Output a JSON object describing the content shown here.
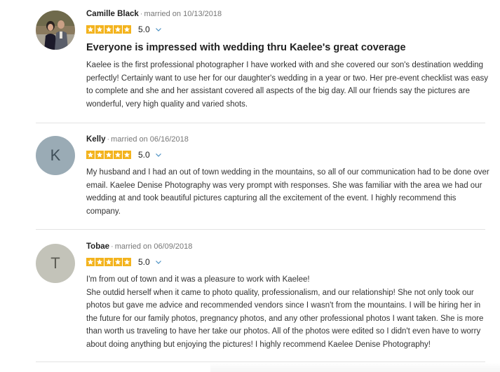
{
  "reviews": [
    {
      "name": "Camille Black",
      "married_text": "married on 10/13/2018",
      "rating": 5,
      "rating_text": "5.0",
      "avatar": "photo",
      "title": "Everyone is impressed with wedding thru Kaelee's great coverage",
      "body_lines": [
        "Kaelee is the first professional photographer I have worked with and she covered our son's destination wedding perfectly! Certainly want to use her for our daughter's wedding in a year or two. Her pre-event checklist was easy to complete and she and her assistant covered all aspects of the big day. All our friends say the pictures are wonderful, very high quality and varied shots."
      ]
    },
    {
      "name": "Kelly",
      "married_text": "married on 06/16/2018",
      "rating": 5,
      "rating_text": "5.0",
      "avatar_letter": "K",
      "body_lines": [
        "My husband and I had an out of town wedding in the mountains, so all of our communication had to be done over email. Kaelee Denise Photography was very prompt with responses. She was familiar with the area we had our wedding at and took beautiful pictures capturing all the excitement of the event. I highly recommend this company."
      ]
    },
    {
      "name": "Tobae",
      "married_text": "married on 06/09/2018",
      "rating": 5,
      "rating_text": "5.0",
      "avatar_letter": "T",
      "body_lines": [
        "I'm from out of town and it was a pleasure to work with Kaelee!",
        "She outdid herself when it came to photo quality, professionalism, and our relationship! She not only took our photos but gave me advice and recommended vendors since I wasn't from the mountains. I will be hiring her in the future for our family photos, pregnancy photos, and any other professional photos I want taken. She is more than worth us traveling to have her take our photos. All of the photos were edited so I didn't even have to worry about doing anything but enjoying the pictures! I highly recommend Kaelee Denise Photography!"
      ]
    }
  ],
  "colors": {
    "star": "#f3b31d",
    "chevron": "#4a90c2",
    "divider": "#e3e3e3"
  },
  "icons": {
    "star": "star-icon",
    "chevron": "chevron-down-icon"
  }
}
